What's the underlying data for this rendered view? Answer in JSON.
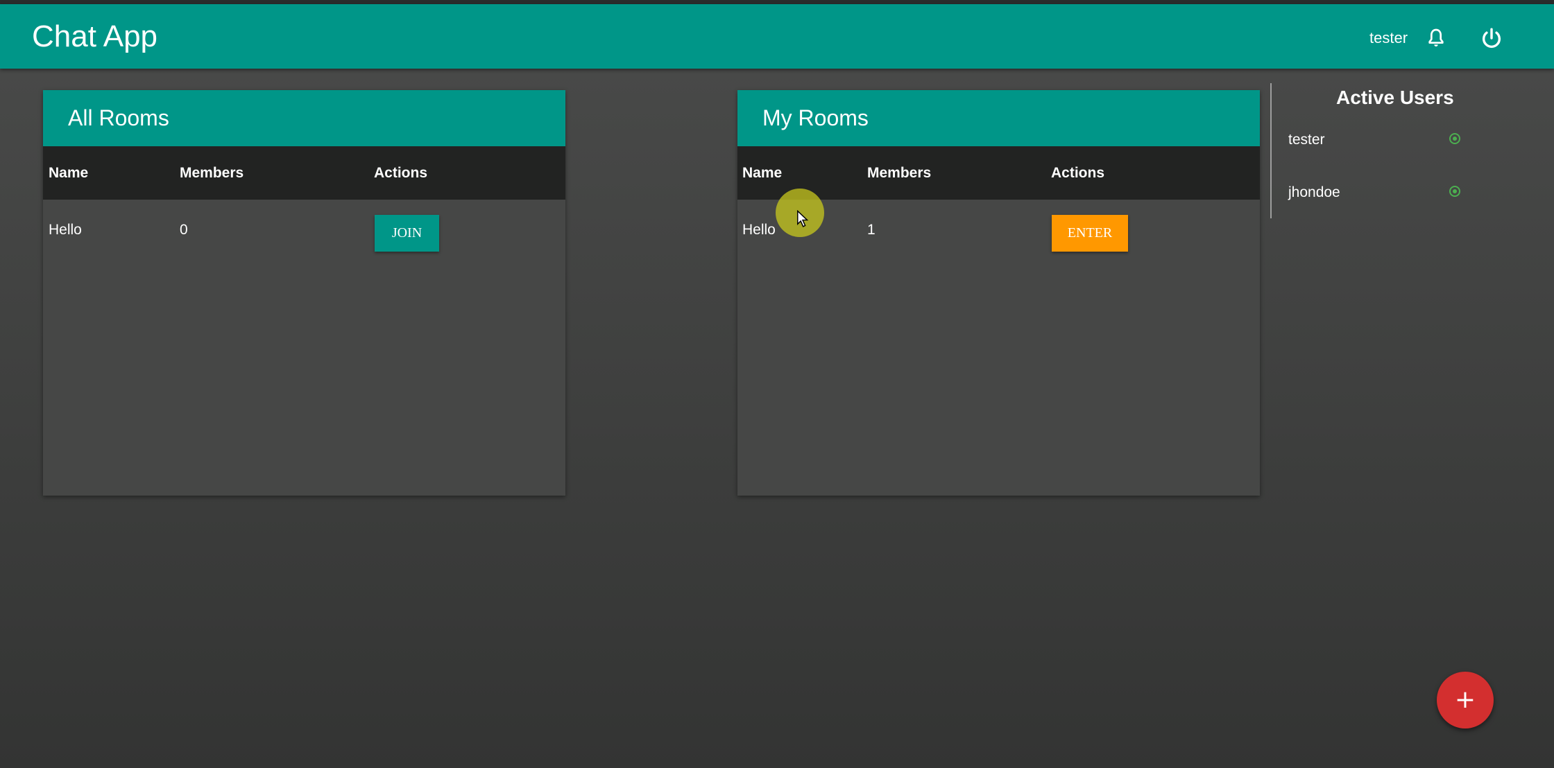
{
  "app": {
    "title": "Chat App"
  },
  "header": {
    "username": "tester",
    "notification_icon": "bell-icon",
    "logout_icon": "power-icon"
  },
  "colors": {
    "primary": "#009688",
    "accent": "#ff9800",
    "fab": "#d32f2f",
    "online": "#4caf50"
  },
  "all_rooms": {
    "title": "All Rooms",
    "columns": [
      "Name",
      "Members",
      "Actions"
    ],
    "rows": [
      {
        "name": "Hello",
        "members": "0",
        "action": "JOIN"
      }
    ]
  },
  "my_rooms": {
    "title": "My Rooms",
    "columns": [
      "Name",
      "Members",
      "Actions"
    ],
    "rows": [
      {
        "name": "Hello",
        "members": "1",
        "action": "ENTER"
      }
    ]
  },
  "active_users": {
    "title": "Active Users",
    "users": [
      {
        "name": "tester",
        "status_icon": "online-status-icon"
      },
      {
        "name": "jhondoe",
        "status_icon": "online-status-icon"
      }
    ]
  },
  "fab": {
    "label": "+"
  }
}
